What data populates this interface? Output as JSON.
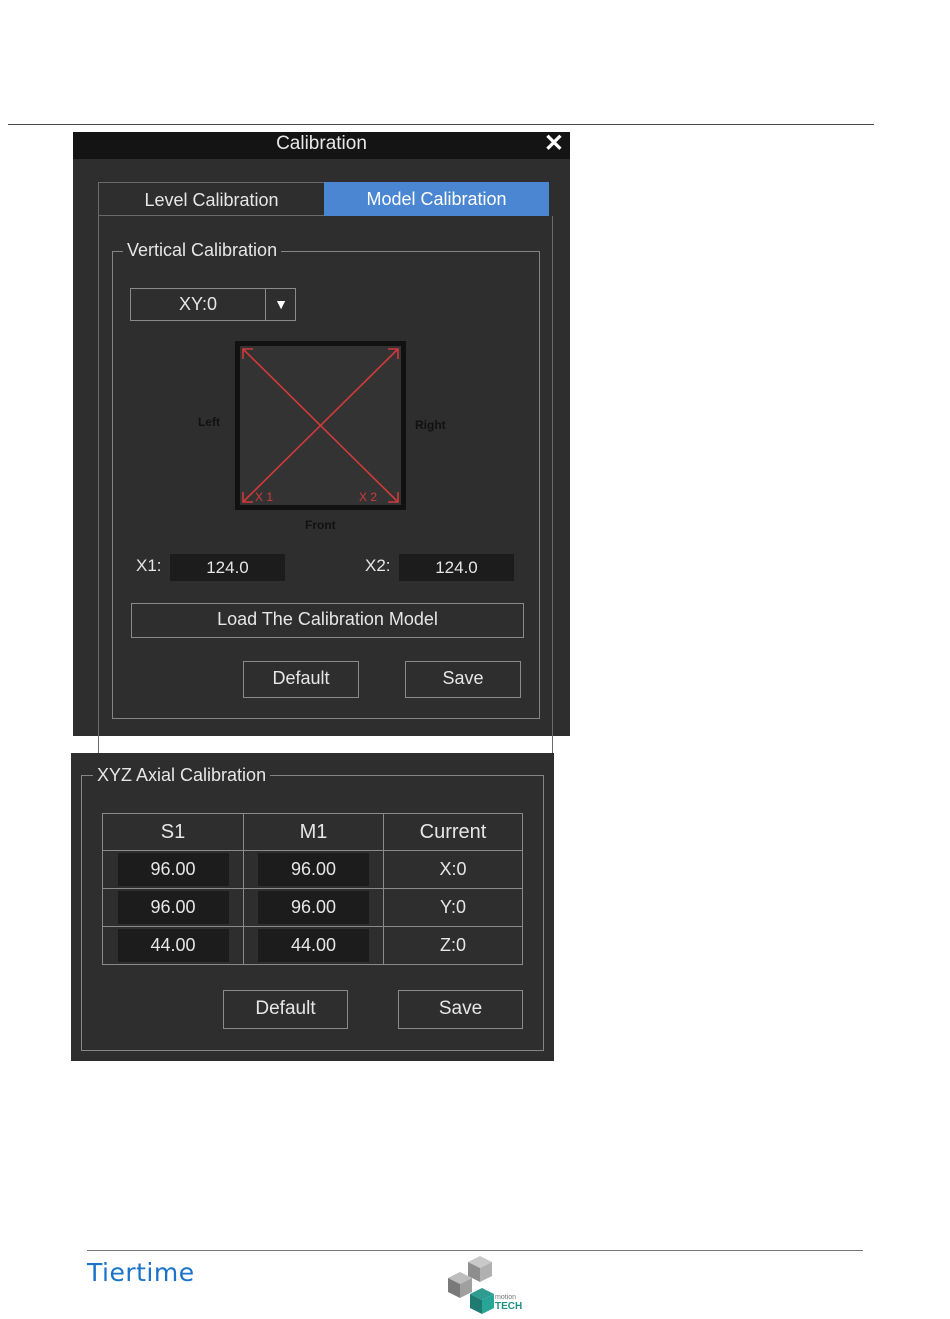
{
  "dialog": {
    "title": "Calibration",
    "close_icon": "close-icon",
    "tabs": [
      {
        "label": "Level Calibration",
        "active": false
      },
      {
        "label": "Model Calibration",
        "active": true
      }
    ],
    "vertical": {
      "legend": "Vertical Calibration",
      "select_value": "XY:0",
      "dropdown_icon": "triangle-down-icon",
      "diagram": {
        "left": "Left",
        "right": "Right",
        "front": "Front",
        "x1_marker": "X 1",
        "x2_marker": "X 2"
      },
      "x1_label": "X1:",
      "x1_value": "124.0",
      "x2_label": "X2:",
      "x2_value": "124.0",
      "load_button": "Load The Calibration Model",
      "default_button": "Default",
      "save_button": "Save"
    }
  },
  "xyz": {
    "legend": "XYZ Axial Calibration",
    "headers": [
      "S1",
      "M1",
      "Current"
    ],
    "rows": [
      {
        "s1": "96.00",
        "m1": "96.00",
        "current": "X:0"
      },
      {
        "s1": "96.00",
        "m1": "96.00",
        "current": "Y:0"
      },
      {
        "s1": "44.00",
        "m1": "44.00",
        "current": "Z:0"
      }
    ],
    "default_button": "Default",
    "save_button": "Save"
  },
  "footer": {
    "brand": "Tiertime",
    "logo_text_small": "motion",
    "logo_text_big": "TECH"
  },
  "colors": {
    "dialog_bg": "#2e2e2e",
    "titlebar_bg": "#141414",
    "active_tab": "#4a86d2",
    "diagram_red": "#d23a3a",
    "brand_blue": "#1a73c9"
  }
}
